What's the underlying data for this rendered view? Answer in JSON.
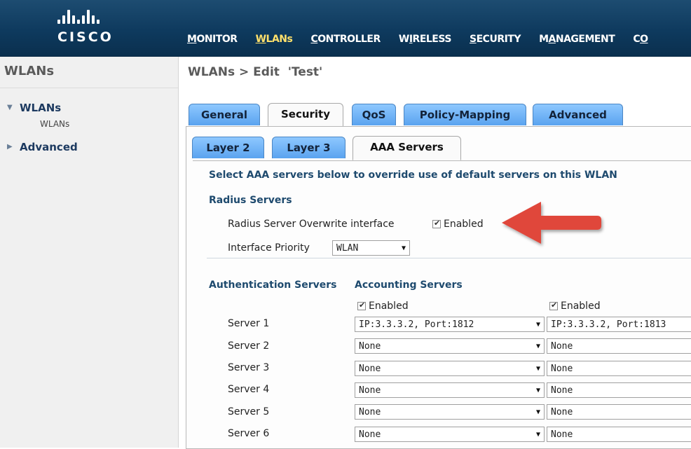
{
  "brand": {
    "name": "cisco"
  },
  "nav": [
    {
      "pre": "",
      "u": "M",
      "post": "ONITOR",
      "active": false
    },
    {
      "pre": "",
      "u": "W",
      "post": "LANs",
      "active": true
    },
    {
      "pre": "",
      "u": "C",
      "post": "ONTROLLER",
      "active": false
    },
    {
      "pre": "W",
      "u": "I",
      "post": "RELESS",
      "active": false
    },
    {
      "pre": "",
      "u": "S",
      "post": "ECURITY",
      "active": false
    },
    {
      "pre": "M",
      "u": "A",
      "post": "NAGEMENT",
      "active": false
    },
    {
      "pre": "C",
      "u": "O",
      "post": "",
      "active": false
    }
  ],
  "sidebar": {
    "title": "WLANs",
    "items": [
      {
        "label": "WLANs",
        "expanded": true,
        "children": [
          "WLANs"
        ]
      },
      {
        "label": "Advanced",
        "expanded": false
      }
    ]
  },
  "page": {
    "title": "WLANs > Edit  'Test'"
  },
  "tabs": [
    {
      "label": "General",
      "active": false
    },
    {
      "label": "Security",
      "active": true
    },
    {
      "label": "QoS",
      "active": false
    },
    {
      "label": "Policy-Mapping",
      "active": false
    },
    {
      "label": "Advanced",
      "active": false
    }
  ],
  "subtabs": [
    {
      "label": "Layer 2",
      "active": false
    },
    {
      "label": "Layer 3",
      "active": false
    },
    {
      "label": "AAA Servers",
      "active": true
    }
  ],
  "aaa": {
    "intro": "Select AAA servers below to override use of default servers on this WLAN",
    "radius_heading": "Radius Servers",
    "overwrite_label": "Radius Server Overwrite interface",
    "overwrite_checkbox": "Enabled",
    "priority_label": "Interface Priority",
    "priority_value": "WLAN",
    "auth_heading": "Authentication Servers",
    "acct_heading": "Accounting Servers",
    "auth_enabled": "Enabled",
    "acct_enabled": "Enabled",
    "servers": [
      {
        "label": "Server 1",
        "auth": "IP:3.3.3.2, Port:1812",
        "acct": "IP:3.3.3.2, Port:1813"
      },
      {
        "label": "Server 2",
        "auth": "None",
        "acct": "None"
      },
      {
        "label": "Server 3",
        "auth": "None",
        "acct": "None"
      },
      {
        "label": "Server 4",
        "auth": "None",
        "acct": "None"
      },
      {
        "label": "Server 5",
        "auth": "None",
        "acct": "None"
      },
      {
        "label": "Server 6",
        "auth": "None",
        "acct": "None"
      }
    ]
  },
  "colors": {
    "topbar": "#0e3a5e",
    "tab_blue": "#5aa3ef",
    "annotation_arrow": "#e0463b"
  },
  "icons": {
    "logo": "cisco-logo",
    "tree_expand": "triangle-down-icon",
    "tree_collapse": "triangle-right-icon",
    "select": "dropdown-arrow-icon",
    "annotation": "red-arrow-icon"
  }
}
